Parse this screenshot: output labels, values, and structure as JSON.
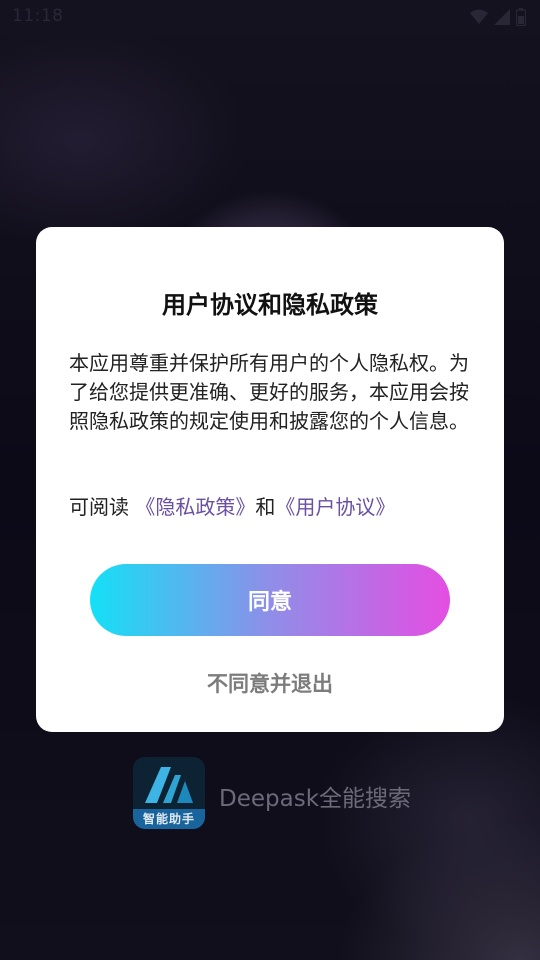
{
  "status_bar": {
    "time": "11:18"
  },
  "background": {
    "app_name": "Deepask全能搜索",
    "logo_label": "智能助手",
    "logo_icon": "app-logo-icon"
  },
  "dialog": {
    "title": "用户协议和隐私政策",
    "body": "本应用尊重并保护所有用户的个人隐私权。为了给您提供更准确、更好的服务，本应用会按照隐私政策的规定使用和披露您的个人信息。",
    "read_prefix": "可阅读 ",
    "privacy_link": "《隐私政策》",
    "conjunction": "和",
    "agreement_link": "《用户协议》",
    "agree_label": "同意",
    "disagree_label": "不同意并退出"
  },
  "colors": {
    "link": "#6a4fa3",
    "button_gradient_start": "#14e0f6",
    "button_gradient_end": "#e44ee2"
  }
}
